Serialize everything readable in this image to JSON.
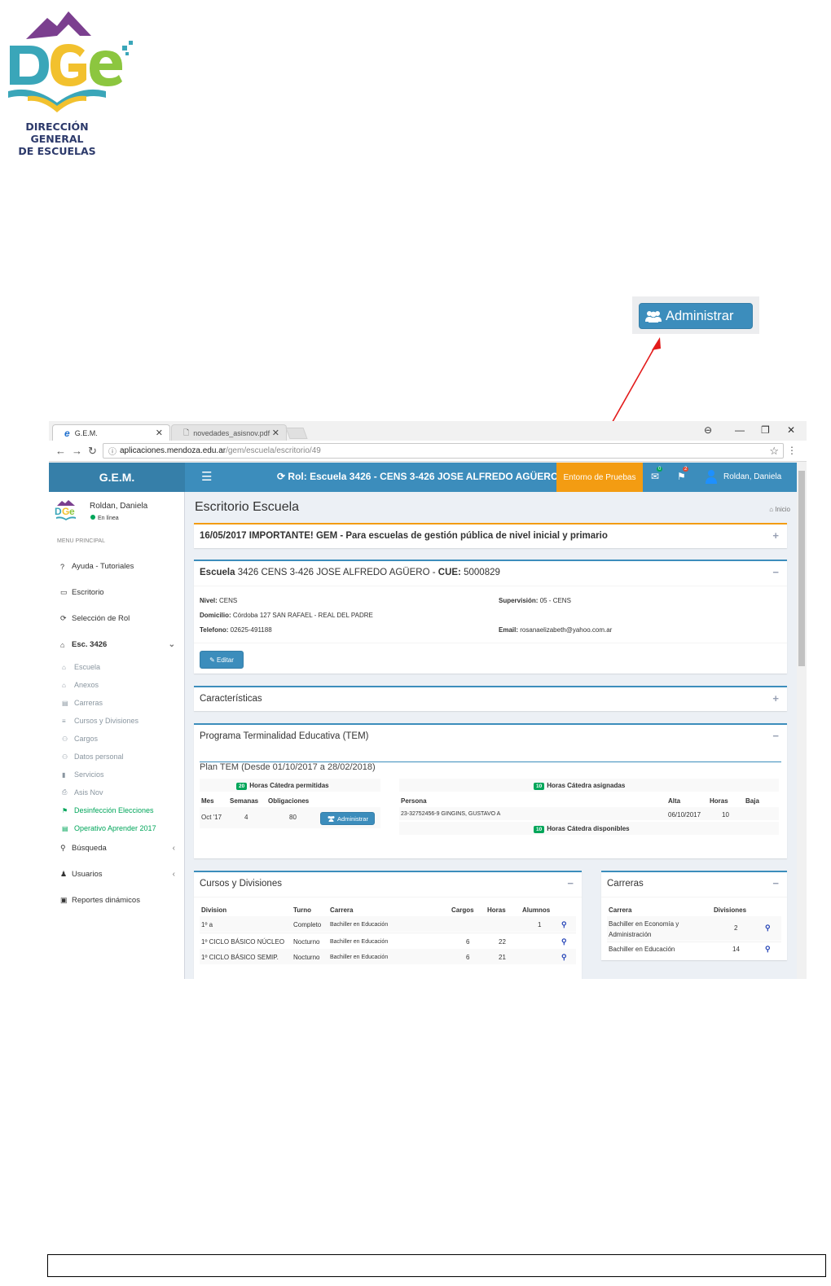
{
  "logo": {
    "initials": "DGe",
    "caption_line1": "DIRECCIÓN GENERAL",
    "caption_line2": "DE ESCUELAS"
  },
  "callout": {
    "button_label": "Administrar",
    "icon": "users-icon",
    "arrow_color": "#e31b1b",
    "highlight_color": "#e31b1b"
  },
  "browser": {
    "tabs": [
      {
        "label": "G.E.M.",
        "active": true
      },
      {
        "label": "novedades_asisnov.pdf",
        "active": false
      }
    ],
    "url_host": "aplicaciones.mendoza.edu.ar",
    "url_path": "/gem/escuela/escritorio/49"
  },
  "topbar": {
    "brand": "G.E.M.",
    "role": "Rol: Escuela 3426 - CENS 3-426 JOSE ALFREDO AGÜERO",
    "environment": "Entorno de Pruebas",
    "mail_count": "0",
    "flag_count": "2",
    "user": "Roldan, Daniela"
  },
  "sidebar": {
    "user_name": "Roldan, Daniela",
    "status": "En línea",
    "header": "MENU PRINCIPAL",
    "items": [
      {
        "icon": "question-icon",
        "label": "Ayuda - Tutoriales"
      },
      {
        "icon": "laptop-icon",
        "label": "Escritorio"
      },
      {
        "icon": "refresh-icon",
        "label": "Selección de Rol"
      },
      {
        "icon": "home-icon",
        "label": "Esc. 3426"
      }
    ],
    "subitems": [
      {
        "icon": "home-icon",
        "label": "Escuela"
      },
      {
        "icon": "home-icon",
        "label": "Anexos"
      },
      {
        "icon": "book-icon",
        "label": "Carreras"
      },
      {
        "icon": "list-icon",
        "label": "Cursos y Divisiones"
      },
      {
        "icon": "users-icon",
        "label": "Cargos"
      },
      {
        "icon": "users-icon",
        "label": "Datos personal"
      },
      {
        "icon": "bookmark-icon",
        "label": "Servicios"
      },
      {
        "icon": "print-icon",
        "label": "Asis Nov"
      },
      {
        "icon": "flag-icon",
        "label": "Desinfección Elecciones"
      },
      {
        "icon": "book-icon",
        "label": "Operativo Aprender 2017"
      }
    ],
    "bottom_items": [
      {
        "icon": "search-icon",
        "label": "Búsqueda"
      },
      {
        "icon": "user-icon",
        "label": "Usuarios"
      },
      {
        "icon": "file-excel-icon",
        "label": "Reportes dinámicos"
      }
    ]
  },
  "content": {
    "page_title": "Escritorio Escuela",
    "breadcrumb": "Inicio",
    "notice": "16/05/2017 IMPORTANTE! GEM - Para escuelas de gestión pública de nivel inicial y primario",
    "school": {
      "label": "Escuela",
      "name": "3426 CENS 3-426 JOSE ALFREDO AGÜERO",
      "cue_label": "CUE:",
      "cue": "5000829",
      "nivel_label": "Nivel:",
      "nivel": "CENS",
      "domicilio_label": "Domicilio:",
      "domicilio": "Córdoba 127 SAN RAFAEL - REAL DEL PADRE",
      "telefono_label": "Telefono:",
      "telefono": "02625-491188",
      "supervision_label": "Supervisión:",
      "supervision": "05 - CENS",
      "email_label": "Email:",
      "email": "rosanaelizabeth@yahoo.com.ar",
      "edit_button": "Editar"
    },
    "caracteristicas_title": "Características",
    "tem": {
      "title": "Programa Terminalidad Educativa (TEM)",
      "plan": "Plan TEM (Desde 01/10/2017 a 28/02/2018)",
      "permitidas_badge": "20",
      "permitidas_label": "Horas Cátedra permitidas",
      "asignadas_badge": "10",
      "asignadas_label": "Horas Cátedra asignadas",
      "disponibles_badge": "10",
      "disponibles_label": "Horas Cátedra disponibles",
      "left_headers": [
        "Mes",
        "Semanas",
        "Obligaciones"
      ],
      "left_row": {
        "mes": "Oct '17",
        "semanas": "4",
        "obligaciones": "80"
      },
      "admin_button": "Administrar",
      "right_headers": [
        "Persona",
        "Alta",
        "Horas",
        "Baja"
      ],
      "right_row": {
        "persona": "23-32752456-9 GINGINS, GUSTAVO A",
        "alta": "06/10/2017",
        "horas": "10",
        "baja": ""
      }
    },
    "cursos": {
      "title": "Cursos y Divisiones",
      "headers": [
        "Division",
        "Turno",
        "Carrera",
        "Cargos",
        "Horas",
        "Alumnos"
      ],
      "rows": [
        {
          "division": "1º a",
          "turno": "Completo",
          "carrera": "Bachiller en Educación",
          "cargos": "",
          "horas": "",
          "alumnos": "1"
        },
        {
          "division": "1º CICLO BÁSICO NÚCLEO",
          "turno": "Nocturno",
          "carrera": "Bachiller en Educación",
          "cargos": "6",
          "horas": "22",
          "alumnos": ""
        },
        {
          "division": "1º CICLO BÁSICO SEMIP.",
          "turno": "Nocturno",
          "carrera": "Bachiller en Educación",
          "cargos": "6",
          "horas": "21",
          "alumnos": ""
        }
      ]
    },
    "carreras": {
      "title": "Carreras",
      "headers": [
        "Carrera",
        "Divisiones"
      ],
      "rows": [
        {
          "carrera_l1": "Bachiller en Economía y",
          "carrera_l2": "Administración",
          "divisiones": "2"
        },
        {
          "carrera_l1": "Bachiller en Educación",
          "carrera_l2": "",
          "divisiones": "14"
        }
      ]
    }
  },
  "colors": {
    "primary": "#3c8dbc",
    "primary_dark": "#367fa9",
    "warning": "#f39c12",
    "success": "#00a65a",
    "content_bg": "#ecf0f5"
  }
}
